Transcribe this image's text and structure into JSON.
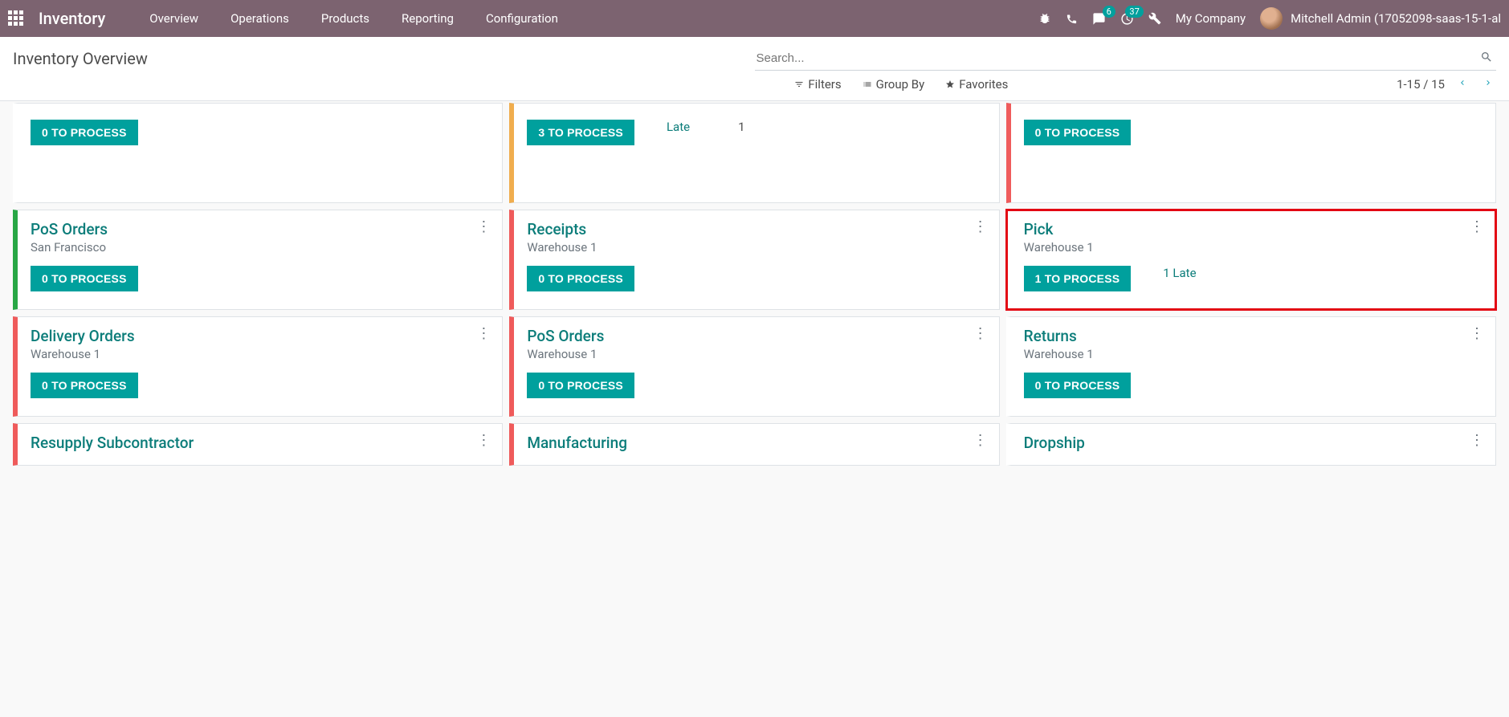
{
  "navbar": {
    "brand": "Inventory",
    "menu": [
      "Overview",
      "Operations",
      "Products",
      "Reporting",
      "Configuration"
    ],
    "badges": {
      "messages": "6",
      "activities": "37"
    },
    "company": "My Company",
    "user": "Mitchell Admin (17052098-saas-15-1-al"
  },
  "control": {
    "breadcrumb": "Inventory Overview",
    "search_placeholder": "Search...",
    "filters_label": "Filters",
    "groupby_label": "Group By",
    "favorites_label": "Favorites",
    "pager": "1-15 / 15"
  },
  "cards": {
    "row0": {
      "c0": {
        "process": "0 TO PROCESS"
      },
      "c1": {
        "process": "3 TO PROCESS",
        "late_label": "Late",
        "late_count": "1"
      },
      "c2": {
        "process": "0 TO PROCESS"
      }
    },
    "row1": {
      "c0": {
        "title": "PoS Orders",
        "subtitle": "San Francisco",
        "process": "0 TO PROCESS"
      },
      "c1": {
        "title": "Receipts",
        "subtitle": "Warehouse 1",
        "process": "0 TO PROCESS"
      },
      "c2": {
        "title": "Pick",
        "subtitle": "Warehouse 1",
        "process": "1 TO PROCESS",
        "late_combined": "1 Late"
      }
    },
    "row2": {
      "c0": {
        "title": "Delivery Orders",
        "subtitle": "Warehouse 1",
        "process": "0 TO PROCESS"
      },
      "c1": {
        "title": "PoS Orders",
        "subtitle": "Warehouse 1",
        "process": "0 TO PROCESS"
      },
      "c2": {
        "title": "Returns",
        "subtitle": "Warehouse 1",
        "process": "0 TO PROCESS"
      }
    },
    "row3": {
      "c0": {
        "title": "Resupply Subcontractor"
      },
      "c1": {
        "title": "Manufacturing"
      },
      "c2": {
        "title": "Dropship"
      }
    }
  }
}
